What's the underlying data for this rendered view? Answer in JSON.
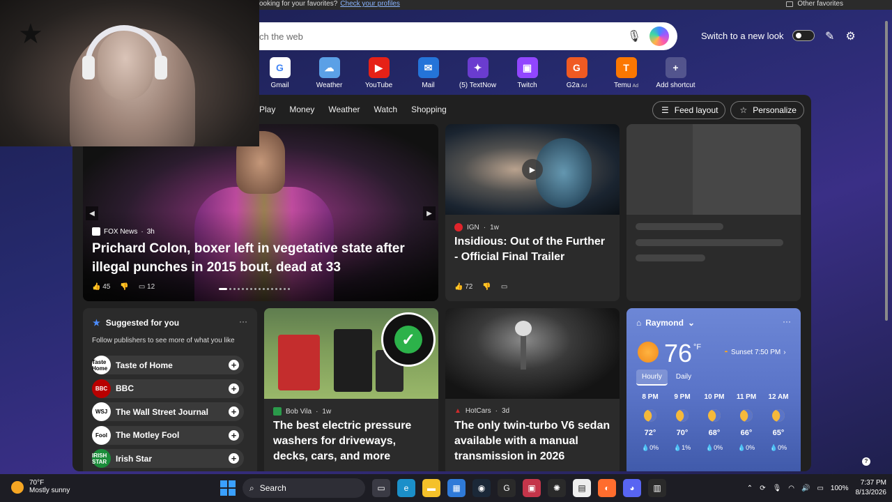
{
  "favorites_bar": {
    "hint": "ooking for your favorites?",
    "link": "Check your profiles",
    "other": "Other favorites"
  },
  "search": {
    "placeholder": "ch the web"
  },
  "header": {
    "new_look": "Switch to a new look"
  },
  "shortcuts": [
    {
      "label": "Gmail",
      "ad": "",
      "icon": "google-icon",
      "color": "#ffffff",
      "glyph": "G"
    },
    {
      "label": "Weather",
      "ad": "",
      "icon": "weather-icon",
      "color": "#5ba0e6",
      "glyph": "☁"
    },
    {
      "label": "YouTube",
      "ad": "",
      "icon": "youtube-icon",
      "color": "#e62117",
      "glyph": "▶"
    },
    {
      "label": "Mail",
      "ad": "",
      "icon": "mail-icon",
      "color": "#2474d9",
      "glyph": "✉"
    },
    {
      "label": "(5) TextNow",
      "ad": "",
      "icon": "textnow-icon",
      "color": "#6a3ccf",
      "glyph": "✦"
    },
    {
      "label": "Twitch",
      "ad": "",
      "icon": "twitch-icon",
      "color": "#9146ff",
      "glyph": "▣"
    },
    {
      "label": "G2a",
      "ad": "Ad",
      "icon": "g2a-icon",
      "color": "#f05a22",
      "glyph": "G"
    },
    {
      "label": "Temu",
      "ad": "Ad",
      "icon": "temu-icon",
      "color": "#fb7701",
      "glyph": "T"
    },
    {
      "label": "Add shortcut",
      "ad": "",
      "icon": "add-icon",
      "color": "#ffffff33",
      "glyph": "+"
    }
  ],
  "topics": [
    "Play",
    "Money",
    "Weather",
    "Watch",
    "Shopping"
  ],
  "feed_buttons": {
    "layout": "Feed layout",
    "personalize": "Personalize"
  },
  "hero": {
    "source": "FOX News",
    "age": "3h",
    "title": "Prichard Colon, boxer left in vegetative state after illegal punches in 2015 bout, dead at 33",
    "likes": "45",
    "comments": "12"
  },
  "ign": {
    "source": "IGN",
    "age": "1w",
    "title": "Insidious: Out of the Further - Official Final Trailer",
    "likes": "72"
  },
  "suggested": {
    "title": "Suggested for you",
    "subtitle": "Follow publishers to see more of what you like",
    "publishers": [
      {
        "name": "Taste of Home",
        "logo": "Taste Home",
        "bg": "#ffffff"
      },
      {
        "name": "BBC",
        "logo": "BBC",
        "bg": "#b80000"
      },
      {
        "name": "The Wall Street Journal",
        "logo": "WSJ",
        "bg": "#ffffff"
      },
      {
        "name": "The Motley Fool",
        "logo": "Fool",
        "bg": "#ffffff"
      },
      {
        "name": "Irish Star",
        "logo": "IRISH STAR",
        "bg": "#1a8c3a"
      }
    ]
  },
  "bobvila": {
    "source": "Bob Vila",
    "age": "1w",
    "title": "The best electric pressure washers for driveways, decks, cars, and more"
  },
  "hotcars": {
    "source": "HotCars",
    "age": "3d",
    "title": "The only twin-turbo V6 sedan available with a manual transmission in 2026"
  },
  "weather": {
    "location": "Raymond",
    "temp": "76",
    "unit": "°F",
    "sunset": "Sunset 7:50 PM",
    "tabs": [
      "Hourly",
      "Daily"
    ],
    "hours": [
      {
        "time": "8 PM",
        "temp": "72°",
        "precip": "0%"
      },
      {
        "time": "9 PM",
        "temp": "70°",
        "precip": "1%"
      },
      {
        "time": "10 PM",
        "temp": "68°",
        "precip": "0%"
      },
      {
        "time": "11 PM",
        "temp": "66°",
        "precip": "0%"
      },
      {
        "time": "12 AM",
        "temp": "65°",
        "precip": "0%"
      }
    ]
  },
  "taskbar": {
    "temp": "70°F",
    "condition": "Mostly sunny",
    "search": "Search",
    "battery": "100%",
    "time": "7:37 PM",
    "date": "8/13/2026",
    "apps": [
      {
        "name": "task-view-icon",
        "color": "#3a3a44",
        "glyph": "▭"
      },
      {
        "name": "edge-icon",
        "color": "#1b8fc9",
        "glyph": "e"
      },
      {
        "name": "file-explorer-icon",
        "color": "#f4c12a",
        "glyph": "▬"
      },
      {
        "name": "store-icon",
        "color": "#2f7ad8",
        "glyph": "▦"
      },
      {
        "name": "steam-icon",
        "color": "#1b2838",
        "glyph": "◉"
      },
      {
        "name": "app-g-icon",
        "color": "#2a2a2a",
        "glyph": "G"
      },
      {
        "name": "roblox-icon",
        "color": "#c4354a",
        "glyph": "▣"
      },
      {
        "name": "chatgpt-icon",
        "color": "#2a2a2a",
        "glyph": "✺"
      },
      {
        "name": "news-app-icon",
        "color": "#eeeeee",
        "glyph": "▤"
      },
      {
        "name": "firefox-icon",
        "color": "#ff6d2e",
        "glyph": "◐"
      },
      {
        "name": "discord-icon",
        "color": "#5865f2",
        "glyph": "◕"
      },
      {
        "name": "bluestacks-icon",
        "color": "#2a2a2a",
        "glyph": "▥"
      }
    ]
  }
}
